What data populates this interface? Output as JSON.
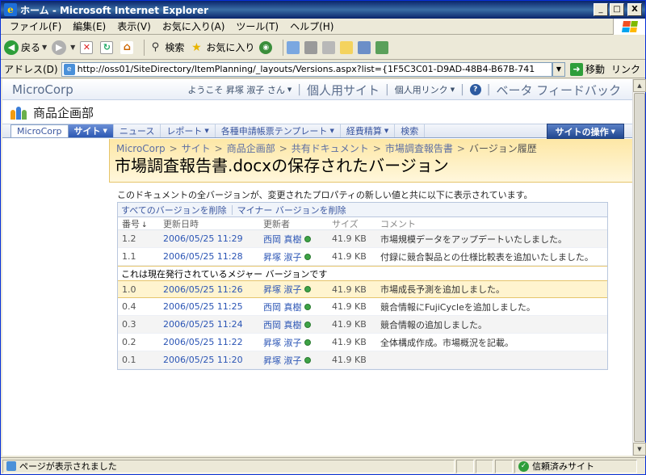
{
  "window": {
    "title": "ホーム - Microsoft Internet Explorer",
    "minimize": "_",
    "maximize": "□",
    "close": "X"
  },
  "menu": [
    "ファイル(F)",
    "編集(E)",
    "表示(V)",
    "お気に入り(A)",
    "ツール(T)",
    "ヘルプ(H)"
  ],
  "toolbar": {
    "back_label": "戻る",
    "search_label": "検索",
    "favorites_label": "お気に入り"
  },
  "address": {
    "label": "アドレス(D)",
    "url": "http://oss01/SiteDirectory/ItemPlanning/_layouts/Versions.aspx?list={1F5C3C01-D9AD-48B4-B67B-741",
    "go_label": "移動",
    "links_label": "リンク"
  },
  "sp": {
    "brand": "MicroCorp",
    "welcome": "ようこそ 昇塚 淑子 さん",
    "my_site": "個人用サイト",
    "my_links": "個人用リンク",
    "help_icon": "?",
    "beta_feedback": "ベータ フィードバック",
    "site_title": "商品企画部",
    "nav": {
      "home": "MicroCorp",
      "items": [
        "サイト",
        "ニュース",
        "レポート",
        "各種申請帳票テンプレート",
        "経費精算",
        "検索"
      ]
    },
    "site_actions": "サイトの操作"
  },
  "breadcrumb": [
    "MicroCorp",
    "サイト",
    "商品企画部",
    "共有ドキュメント",
    "市場調査報告書",
    "バージョン履歴"
  ],
  "page_title": "市場調査報告書.docxの保存されたバージョン",
  "description": "このドキュメントの全バージョンが、変更されたプロパティの新しい値と共に以下に表示されています。",
  "versions": {
    "actions": {
      "delete_all": "すべてのバージョンを削除",
      "delete_minor": "マイナー バージョンを削除"
    },
    "headers": {
      "no": "番号",
      "modified": "更新日時",
      "modified_by": "更新者",
      "size": "サイズ",
      "comment": "コメント"
    },
    "current_banner": "これは現在発行されているメジャー バージョンです",
    "rows_before": [
      {
        "no": "1.2",
        "date": "2006/05/25 11:29",
        "user": "西岡 真樹",
        "size": "41.9 KB",
        "comment": "市場規模データをアップデートいたしました。"
      },
      {
        "no": "1.1",
        "date": "2006/05/25 11:28",
        "user": "昇塚 淑子",
        "size": "41.9 KB",
        "comment": "付録に競合製品との仕様比較表を追加いたしました。"
      }
    ],
    "current": {
      "no": "1.0",
      "date": "2006/05/25 11:26",
      "user": "昇塚 淑子",
      "size": "41.9 KB",
      "comment": "市場成長予測を追加しました。"
    },
    "rows_after": [
      {
        "no": "0.4",
        "date": "2006/05/25 11:25",
        "user": "西岡 真樹",
        "size": "41.9 KB",
        "comment": "競合情報にFujiCycleを追加しました。"
      },
      {
        "no": "0.3",
        "date": "2006/05/25 11:24",
        "user": "西岡 真樹",
        "size": "41.9 KB",
        "comment": "競合情報の追加しました。"
      },
      {
        "no": "0.2",
        "date": "2006/05/25 11:22",
        "user": "昇塚 淑子",
        "size": "41.9 KB",
        "comment": "全体構成作成。市場概況を記載。"
      },
      {
        "no": "0.1",
        "date": "2006/05/25 11:20",
        "user": "昇塚 淑子",
        "size": "41.9 KB",
        "comment": ""
      }
    ]
  },
  "status": {
    "text": "ページが表示されました",
    "zone": "信頼済みサイト"
  }
}
